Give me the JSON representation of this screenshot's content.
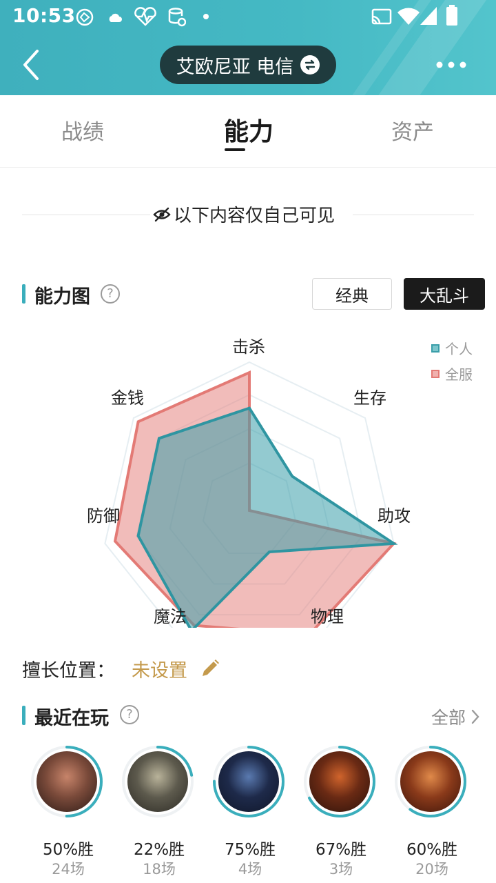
{
  "status_bar": {
    "time": "10:53"
  },
  "header": {
    "server": "艾欧尼亚 电信"
  },
  "tabs": [
    {
      "label": "战绩",
      "active": false
    },
    {
      "label": "能力",
      "active": true
    },
    {
      "label": "资产",
      "active": false
    }
  ],
  "notice": "以下内容仅自己可见",
  "ability": {
    "title": "能力图",
    "modes": [
      "经典",
      "大乱斗"
    ],
    "selected_mode": "大乱斗",
    "legend": [
      {
        "name": "个人",
        "color": "#3a9ea9"
      },
      {
        "name": "全服",
        "color": "#e37a75"
      }
    ]
  },
  "chart_data": {
    "type": "radar",
    "axes": [
      "击杀",
      "生存",
      "助攻",
      "物理",
      "魔法",
      "防御",
      "金钱"
    ],
    "range": [
      0,
      1
    ],
    "series": [
      {
        "name": "全服",
        "values": [
          0.93,
          0.0,
          1.0,
          0.93,
          0.86,
          0.93,
          0.96
        ]
      },
      {
        "name": "个人",
        "values": [
          0.69,
          0.37,
          1.0,
          0.31,
          0.9,
          0.77,
          0.78
        ]
      }
    ]
  },
  "position": {
    "label": "擅长位置：",
    "value": "未设置"
  },
  "recent": {
    "title": "最近在玩",
    "all_label": "全部",
    "champions": [
      {
        "win_rate": "50%胜",
        "games": "24场",
        "win_fraction": 0.5,
        "palette": [
          "#7a4a3a",
          "#c7846a",
          "#2a1a16"
        ]
      },
      {
        "win_rate": "22%胜",
        "games": "18场",
        "win_fraction": 0.22,
        "palette": [
          "#5d5a4d",
          "#b9b39a",
          "#2c2a24"
        ]
      },
      {
        "win_rate": "75%胜",
        "games": "4场",
        "win_fraction": 0.75,
        "palette": [
          "#1e2a4a",
          "#5a7ab0",
          "#0f1628"
        ]
      },
      {
        "win_rate": "67%胜",
        "games": "3场",
        "win_fraction": 0.67,
        "palette": [
          "#6a2a14",
          "#d0642c",
          "#2a120a"
        ]
      },
      {
        "win_rate": "60%胜",
        "games": "20场",
        "win_fraction": 0.6,
        "palette": [
          "#8a3a1a",
          "#e08a4a",
          "#3a140a"
        ]
      }
    ]
  },
  "colors": {
    "accent": "#3aaebc",
    "personal": "#3a9ea9",
    "server": "#e37a75",
    "position_value": "#c49a4c"
  }
}
